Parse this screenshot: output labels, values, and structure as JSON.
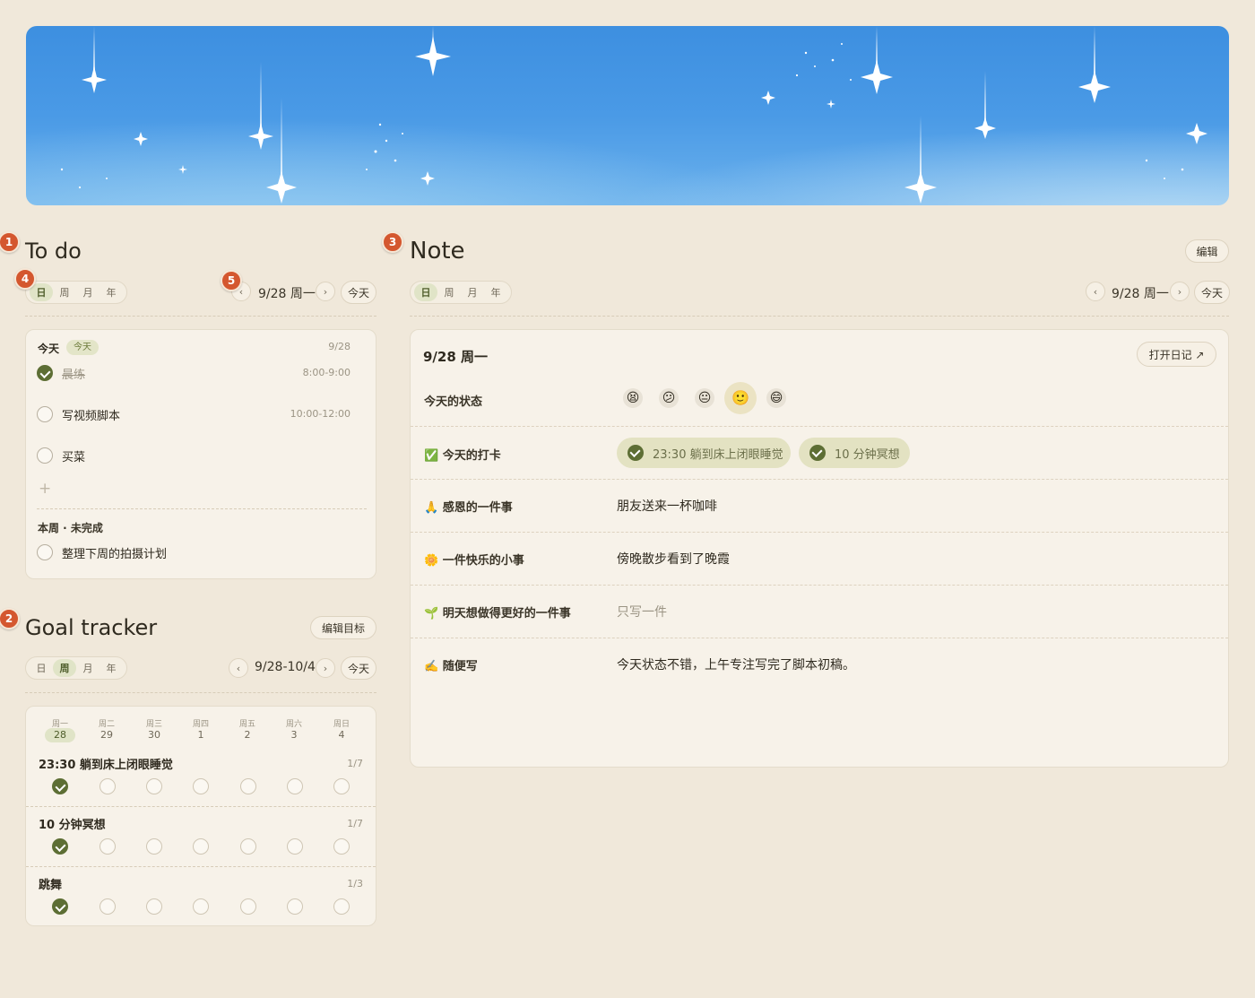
{
  "badges": [
    "1",
    "2",
    "3",
    "4",
    "5"
  ],
  "todo": {
    "title": "To do",
    "views": [
      "日",
      "周",
      "月",
      "年"
    ],
    "active_view": "日",
    "date": "9/28 周一",
    "today_btn": "今天",
    "section_today": "今天",
    "today_tag": "今天",
    "today_date": "9/28",
    "items": [
      {
        "text": "晨练",
        "time": "8:00-9:00",
        "done": true
      },
      {
        "text": "写视频脚本",
        "time": "10:00-12:00",
        "done": false
      },
      {
        "text": "买菜",
        "time": "",
        "done": false
      }
    ],
    "add_symbol": "+",
    "week_section": "本周 · 未完成",
    "week_items": [
      {
        "text": "整理下周的拍摄计划",
        "done": false
      }
    ]
  },
  "goal": {
    "title": "Goal tracker",
    "edit_btn": "编辑目标",
    "views": [
      "日",
      "周",
      "月",
      "年"
    ],
    "active_view": "周",
    "date": "9/28-10/4",
    "today_btn": "今天",
    "weekdays": [
      "周一",
      "周二",
      "周三",
      "周四",
      "周五",
      "周六",
      "周日"
    ],
    "days": [
      "28",
      "29",
      "30",
      "1",
      "2",
      "3",
      "4"
    ],
    "goals": [
      {
        "name": "23:30 躺到床上闭眼睡觉",
        "progress": "1/7",
        "checks": [
          true,
          false,
          false,
          false,
          false,
          false,
          false
        ]
      },
      {
        "name": "10 分钟冥想",
        "progress": "1/7",
        "checks": [
          true,
          false,
          false,
          false,
          false,
          false,
          false
        ]
      },
      {
        "name": "跳舞",
        "progress": "1/3",
        "checks": [
          true,
          false,
          false,
          false,
          false,
          false,
          false
        ]
      }
    ]
  },
  "note": {
    "title": "Note",
    "edit_btn": "编辑",
    "views": [
      "日",
      "周",
      "月",
      "年"
    ],
    "active_view": "日",
    "date": "9/28 周一",
    "today_btn": "今天",
    "card_date": "9/28 周一",
    "open_diary": "打开日记 ↗",
    "mood_label": "今天的状态",
    "moods": [
      "😫",
      "😕",
      "😐",
      "🙂",
      "😄"
    ],
    "selected_mood": 3,
    "checkin_label": "✅ 今天的打卡",
    "checkins": [
      "23:30 躺到床上闭眼睡觉",
      "10 分钟冥想"
    ],
    "rows": [
      {
        "label": "🙏 感恩的一件事",
        "value": "朋友送来一杯咖啡",
        "placeholder": false
      },
      {
        "label": "🌼 一件快乐的小事",
        "value": "傍晚散步看到了晚霞",
        "placeholder": false
      },
      {
        "label": "🌱 明天想做得更好的一件事",
        "value": "只写一件",
        "placeholder": true
      },
      {
        "label": "✍️ 随便写",
        "value": "今天状态不错，上午专注写完了脚本初稿。",
        "placeholder": false
      }
    ]
  },
  "colors": {
    "background": "#f0e8da",
    "accent_green": "#5d6e34",
    "badge": "#d4572f",
    "banner_blue": "#4a9ae6"
  },
  "icons": {
    "prev": "chevron-left-icon",
    "next": "chevron-right-icon",
    "check": "check-icon",
    "add": "plus-icon"
  }
}
